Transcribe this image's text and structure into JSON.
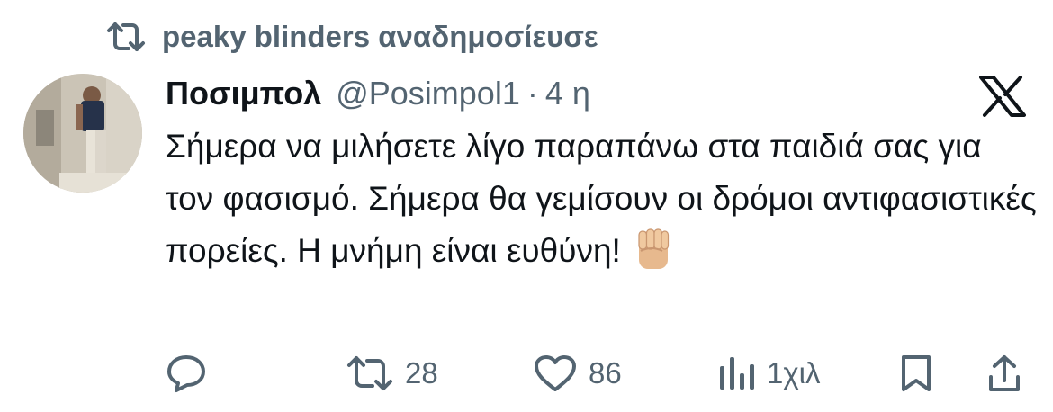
{
  "repost": {
    "icon": "repost-icon",
    "text": "peaky blinders αναδημοσίευσε"
  },
  "tweet": {
    "author_name": "Ποσιμπολ",
    "handle": "@Posimpol1",
    "separator": "·",
    "time": "4 η",
    "text": "Σήμερα να μιλήσετε λίγο παραπάνω στα παιδιά σας για τον φασισμό. Σήμερα θα γεμίσουν οι δρόμοι αντιφασιστικές πορείες. Η μνήμη είναι ευθύνη!",
    "emoji": "raised-fist-emoji"
  },
  "actions": {
    "reply": {
      "icon": "reply-icon",
      "count": ""
    },
    "repost": {
      "icon": "repost-icon",
      "count": "28"
    },
    "like": {
      "icon": "heart-icon",
      "count": "86"
    },
    "views": {
      "icon": "views-icon",
      "count": "1χιλ"
    },
    "bookmark": {
      "icon": "bookmark-icon"
    },
    "share": {
      "icon": "share-icon"
    }
  },
  "colors": {
    "text": "#0f1419",
    "secondary": "#536471",
    "background": "#ffffff"
  }
}
